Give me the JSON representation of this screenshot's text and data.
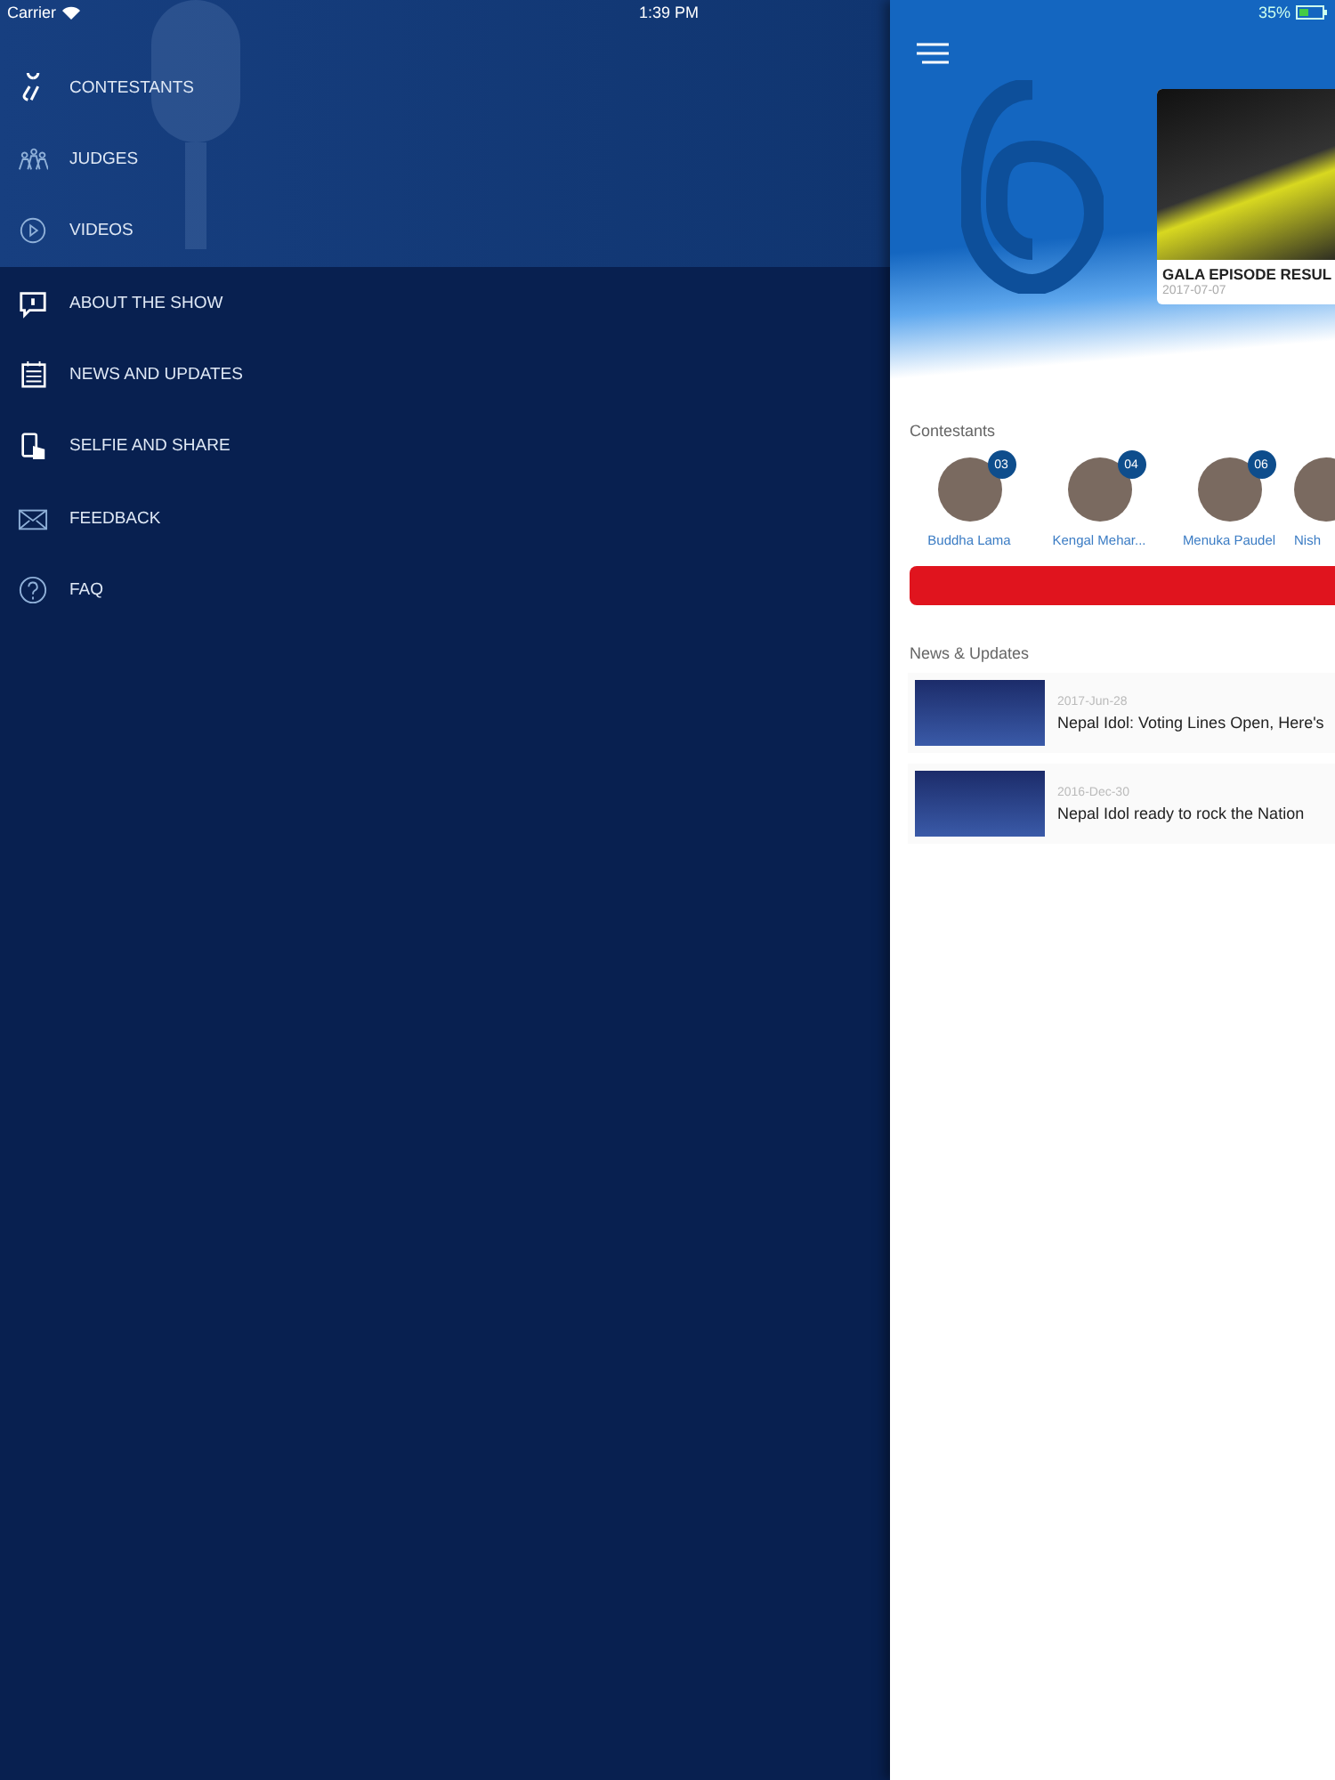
{
  "status_bar": {
    "carrier": "Carrier",
    "time": "1:39 PM",
    "battery": "35%"
  },
  "drawer": {
    "header_items": [
      {
        "label": "CONTESTANTS"
      },
      {
        "label": "JUDGES"
      },
      {
        "label": "VIDEOS"
      }
    ],
    "items": [
      {
        "label": "ABOUT THE SHOW"
      },
      {
        "label": "NEWS AND UPDATES"
      },
      {
        "label": "SELFIE AND SHARE"
      },
      {
        "label": "FEEDBACK"
      },
      {
        "label": "FAQ"
      }
    ]
  },
  "featured": {
    "title": "GALA EPISODE RESUL",
    "date": "2017-07-07"
  },
  "contestants": {
    "heading": "Contestants",
    "items": [
      {
        "number": "03",
        "name": "Buddha Lama"
      },
      {
        "number": "04",
        "name": "Kengal Mehar..."
      },
      {
        "number": "06",
        "name": "Menuka Paudel"
      },
      {
        "name": "Nish"
      }
    ]
  },
  "news": {
    "heading": "News & Updates",
    "items": [
      {
        "date": "2017-Jun-28",
        "title": "Nepal Idol: Voting Lines Open, Here's"
      },
      {
        "date": "2016-Dec-30",
        "title": "Nepal Idol ready to rock the Nation"
      }
    ]
  }
}
